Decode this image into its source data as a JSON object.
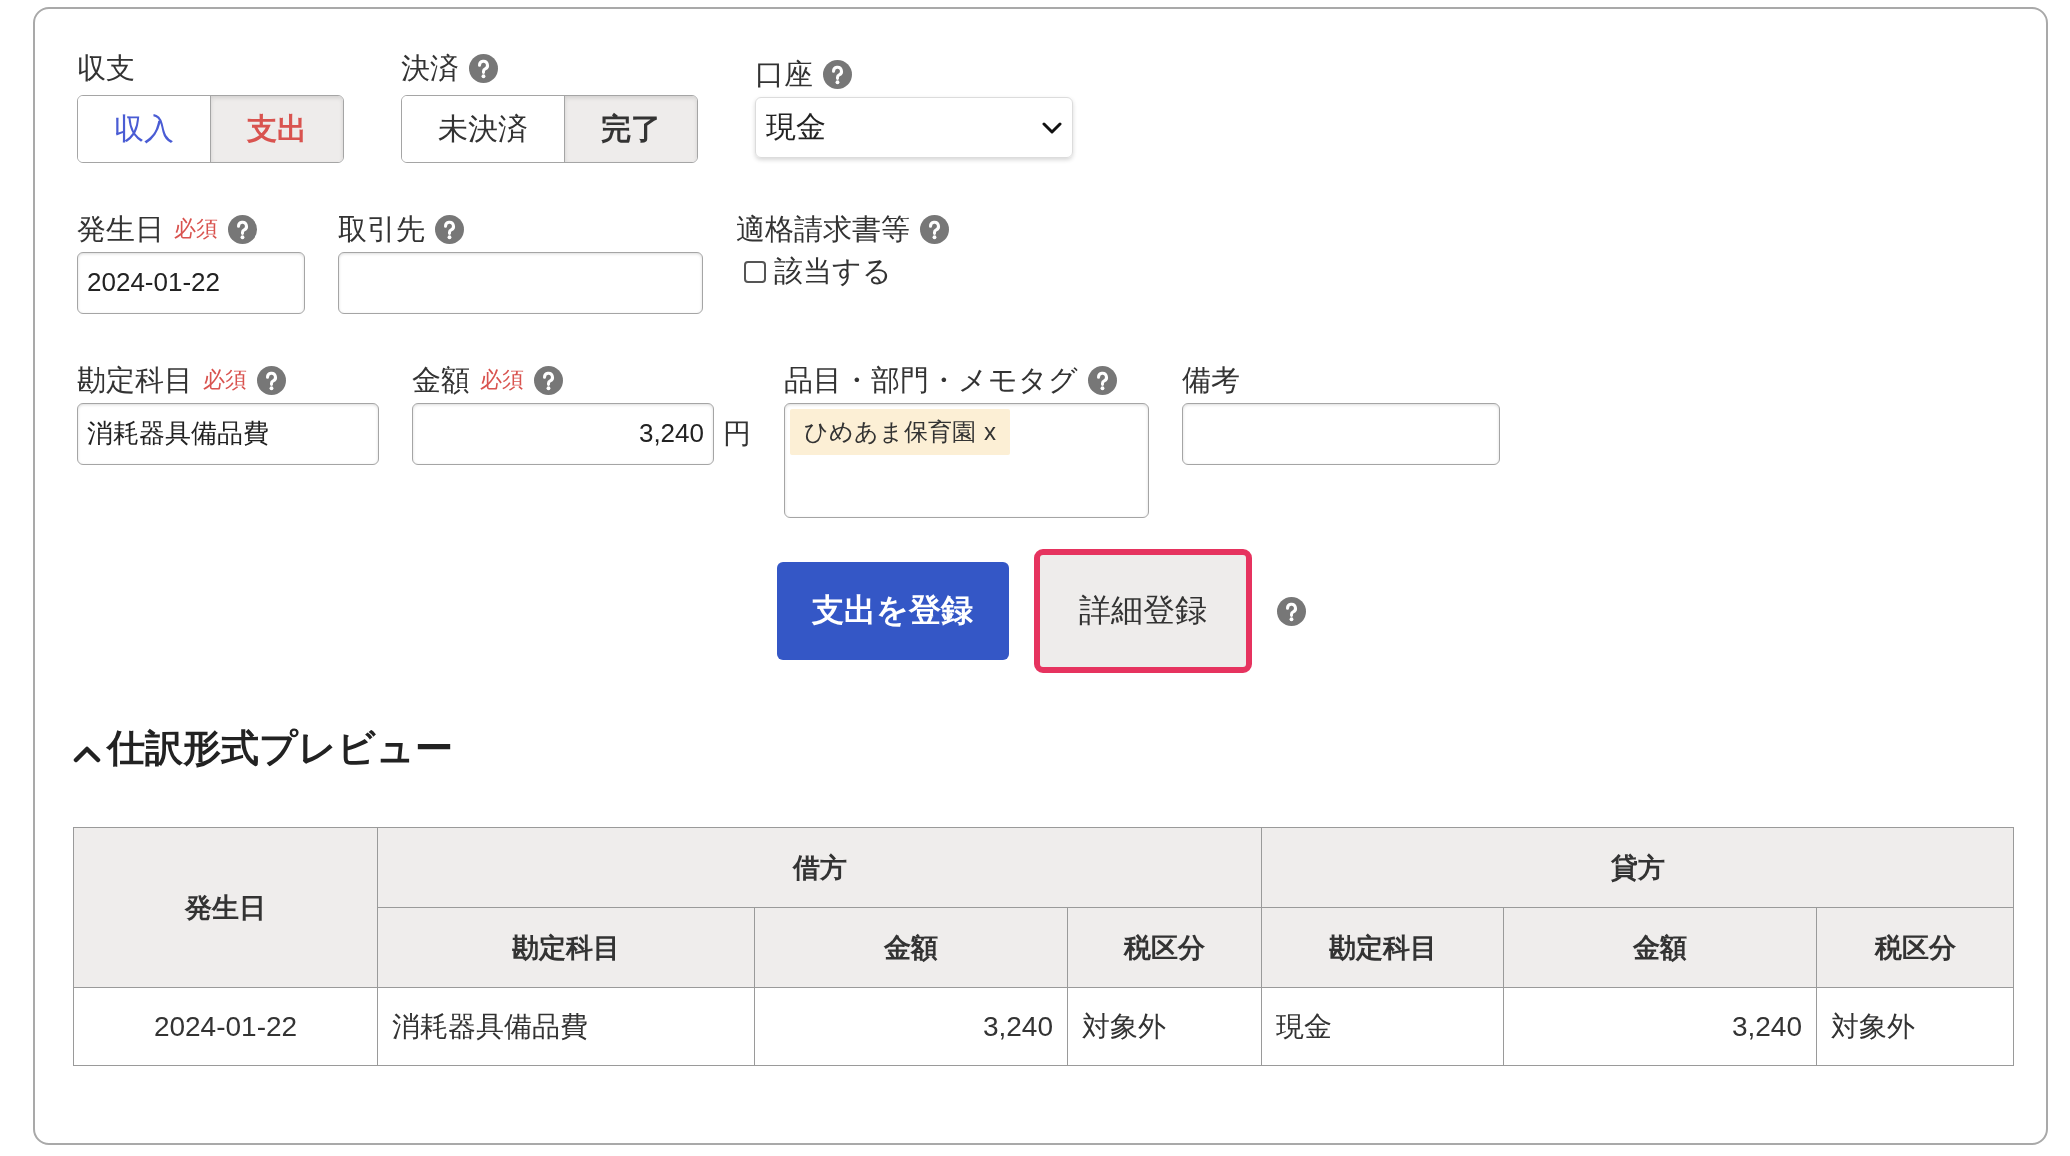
{
  "form": {
    "rows": [
      {
        "fields": [
          {
            "kind": "toggle",
            "label": "収支",
            "help": false,
            "options": [
              {
                "label": "収入",
                "color": "#4a5cd4",
                "selected": false
              },
              {
                "label": "支出",
                "color": "#d9534f",
                "selected": true
              }
            ]
          },
          {
            "kind": "toggle",
            "label": "決済",
            "help": true,
            "options": [
              {
                "label": "未決済",
                "selected": false
              },
              {
                "label": "完了",
                "selected": true
              }
            ]
          },
          {
            "kind": "select",
            "label": "口座",
            "help": true,
            "value": "現金"
          }
        ]
      },
      {
        "fields": [
          {
            "kind": "text",
            "label": "発生日",
            "required": "必須",
            "help": true,
            "value": "2024-01-22"
          },
          {
            "kind": "text",
            "label": "取引先",
            "help": true
          },
          {
            "kind": "checkbox",
            "label": "適格請求書等",
            "help": true,
            "option": {
              "label": "該当する",
              "checked": false
            }
          }
        ]
      },
      {
        "fields": [
          {
            "kind": "text",
            "label": "勘定科目",
            "required": "必須",
            "help": true,
            "value": "消耗器具備品費"
          },
          {
            "kind": "amount",
            "label": "金額",
            "required": "必須",
            "help": true,
            "value": "3,240",
            "unit": "円"
          },
          {
            "kind": "tags",
            "label": "品目・部門・メモタグ",
            "help": true,
            "tags": [
              {
                "label": "ひめあま保育園",
                "remove": "x"
              }
            ]
          },
          {
            "kind": "text",
            "label": "備考",
            "help": false
          }
        ]
      }
    ]
  },
  "actions": {
    "buttons": [
      {
        "label": "支出を登録",
        "kind": "primary",
        "highlighted": false
      },
      {
        "label": "詳細登録",
        "kind": "secondary",
        "highlighted": true
      }
    ],
    "help": true
  },
  "preview": {
    "title": "仕訳形式プレビュー",
    "expanded": true,
    "table": {
      "date_column": {
        "label": "発生日",
        "kind": "date"
      },
      "groups": [
        {
          "label": "借方",
          "columns": [
            {
              "label": "勘定科目",
              "kind": "text"
            },
            {
              "label": "金額",
              "kind": "amount"
            },
            {
              "label": "税区分",
              "kind": "text"
            }
          ]
        },
        {
          "label": "貸方",
          "columns": [
            {
              "label": "勘定科目",
              "kind": "text"
            },
            {
              "label": "金額",
              "kind": "amount"
            },
            {
              "label": "税区分",
              "kind": "text"
            }
          ]
        }
      ],
      "rows": [
        [
          "2024-01-22",
          "消耗器具備品費",
          "3,240",
          "対象外",
          "現金",
          "3,240",
          "対象外"
        ]
      ]
    }
  }
}
